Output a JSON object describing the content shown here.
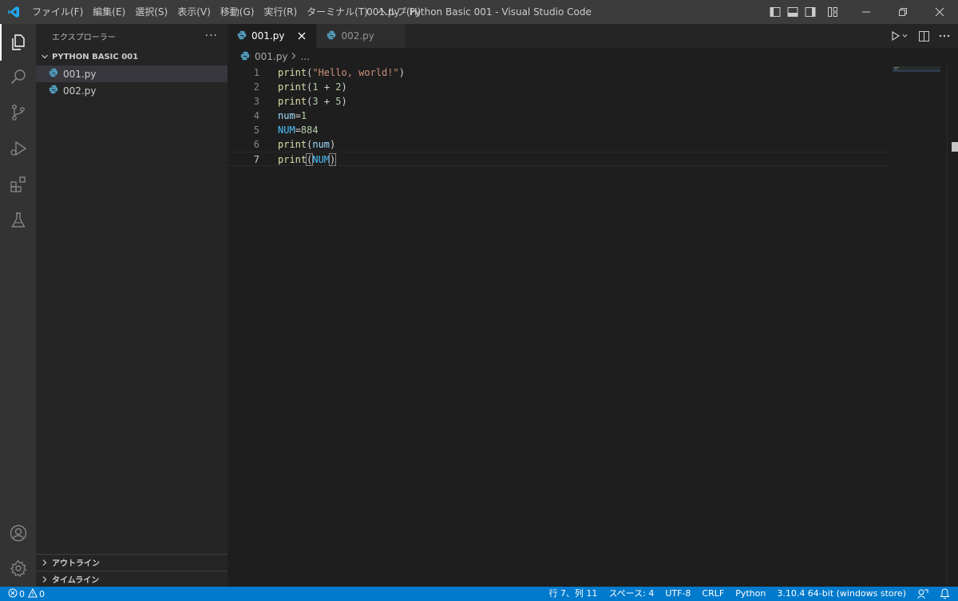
{
  "menu": [
    "ファイル(F)",
    "編集(E)",
    "選択(S)",
    "表示(V)",
    "移動(G)",
    "実行(R)",
    "ターミナル(T)",
    "ヘルプ(H)"
  ],
  "window_title": "001.py - Python Basic 001 - Visual Studio Code",
  "sidebar": {
    "header": "エクスプローラー",
    "more": "···",
    "folder": "PYTHON BASIC 001",
    "files": [
      "001.py",
      "002.py"
    ],
    "outline": "アウトライン",
    "timeline": "タイムライン"
  },
  "tabs": [
    {
      "label": "001.py",
      "active": true
    },
    {
      "label": "002.py",
      "active": false
    }
  ],
  "breadcrumb": {
    "file": "001.py",
    "rest": "..."
  },
  "editor": {
    "line_numbers": [
      "1",
      "2",
      "3",
      "4",
      "5",
      "6",
      "7"
    ],
    "lines": [
      [
        {
          "t": "print",
          "c": "fn"
        },
        {
          "t": "(",
          "c": "br"
        },
        {
          "t": "\"Hello, world!\"",
          "c": "str"
        },
        {
          "t": ")",
          "c": "br"
        }
      ],
      [
        {
          "t": "print",
          "c": "fn"
        },
        {
          "t": "(",
          "c": "br"
        },
        {
          "t": "1",
          "c": "num"
        },
        {
          "t": " + ",
          "c": "br"
        },
        {
          "t": "2",
          "c": "num"
        },
        {
          "t": ")",
          "c": "br"
        }
      ],
      [
        {
          "t": "print",
          "c": "fn"
        },
        {
          "t": "(",
          "c": "br"
        },
        {
          "t": "3",
          "c": "num"
        },
        {
          "t": " + ",
          "c": "br"
        },
        {
          "t": "5",
          "c": "num"
        },
        {
          "t": ")",
          "c": "br"
        }
      ],
      [
        {
          "t": "num",
          "c": "var"
        },
        {
          "t": "=",
          "c": "br"
        },
        {
          "t": "1",
          "c": "num"
        }
      ],
      [
        {
          "t": "NUM",
          "c": "cnst"
        },
        {
          "t": "=",
          "c": "br"
        },
        {
          "t": "884",
          "c": "num"
        }
      ],
      [
        {
          "t": "print",
          "c": "fn"
        },
        {
          "t": "(",
          "c": "br"
        },
        {
          "t": "num",
          "c": "var"
        },
        {
          "t": ")",
          "c": "br"
        }
      ],
      [
        {
          "t": "print",
          "c": "fn"
        },
        {
          "t": "(",
          "c": "br bracket-match"
        },
        {
          "t": "NUM",
          "c": "cnst"
        },
        {
          "t": ")",
          "c": "br bracket-match"
        }
      ]
    ],
    "current_line": 7
  },
  "status": {
    "errors": "0",
    "warnings": "0",
    "position": "行 7、列 11",
    "spaces": "スペース: 4",
    "encoding": "UTF-8",
    "eol": "CRLF",
    "language": "Python",
    "interpreter": "3.10.4 64-bit (windows store)"
  },
  "colors": {
    "accent": "#007acc",
    "titlebar": "#3c3c3c",
    "activitybar": "#333333",
    "sidebar": "#252526",
    "editor": "#1e1e1e",
    "python_icon": "#519aba"
  }
}
